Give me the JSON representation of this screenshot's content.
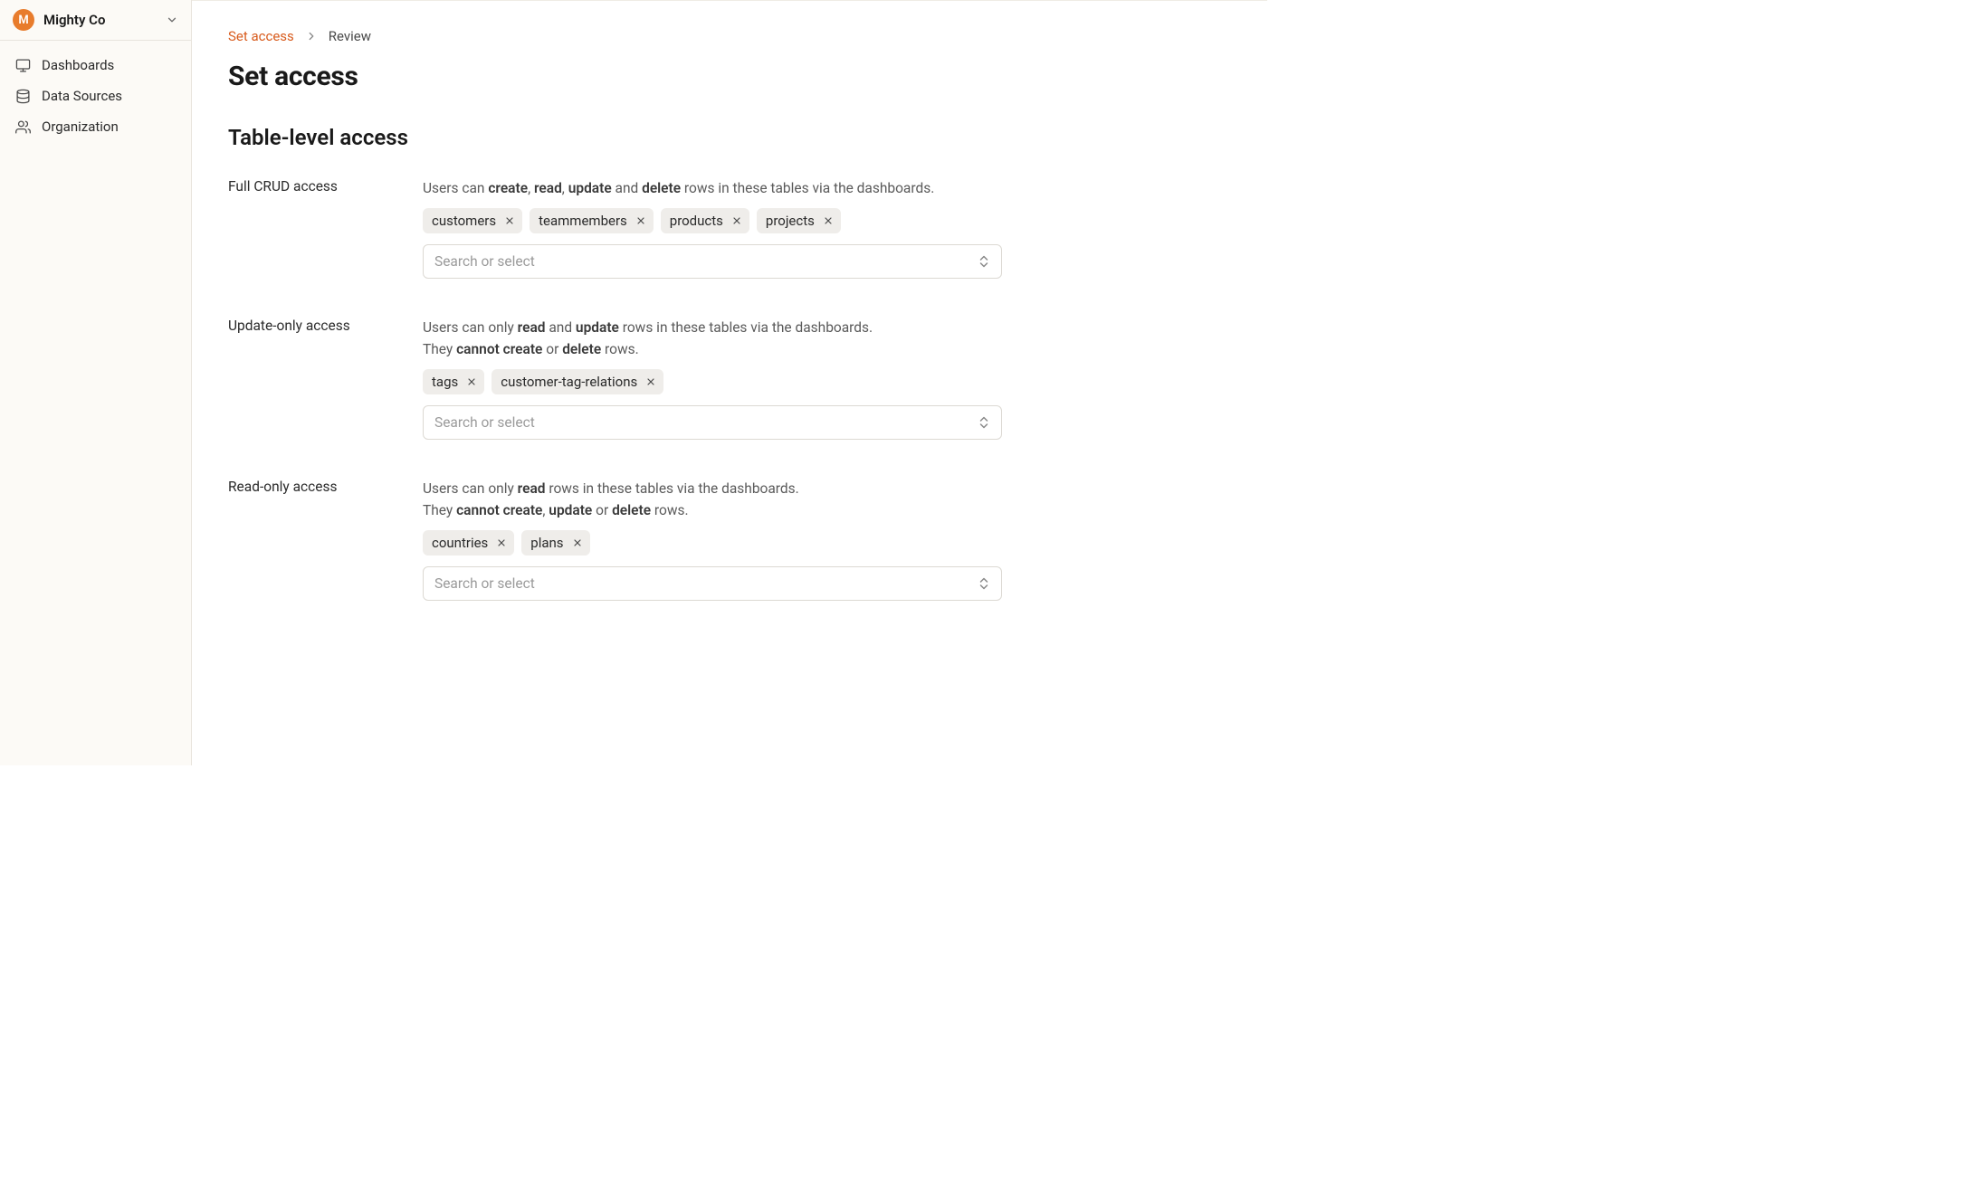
{
  "org": {
    "initial": "M",
    "name": "Mighty Co"
  },
  "nav": {
    "dashboards": "Dashboards",
    "data_sources": "Data Sources",
    "organization": "Organization"
  },
  "breadcrumb": {
    "current": "Set access",
    "next": "Review"
  },
  "page_title": "Set access",
  "section_title": "Table-level access",
  "combo_placeholder": "Search or select",
  "sections": {
    "full_crud": {
      "label": "Full CRUD access",
      "tags": [
        "customers",
        "teammembers",
        "products",
        "projects"
      ]
    },
    "update_only": {
      "label": "Update-only access",
      "tags": [
        "tags",
        "customer-tag-relations"
      ]
    },
    "read_only": {
      "label": "Read-only access",
      "tags": [
        "countries",
        "plans"
      ]
    }
  },
  "desc_words": {
    "users_can": "Users can ",
    "users_can_only": "Users can only ",
    "create": "create",
    "read": "read",
    "update": "update",
    "delete": "delete",
    "and": " and ",
    "comma": ", ",
    "rows_in_tables": " rows in these tables via the dashboards.",
    "they": "They ",
    "cannot_create": "cannot create",
    "or": " or ",
    "rows": " rows."
  }
}
